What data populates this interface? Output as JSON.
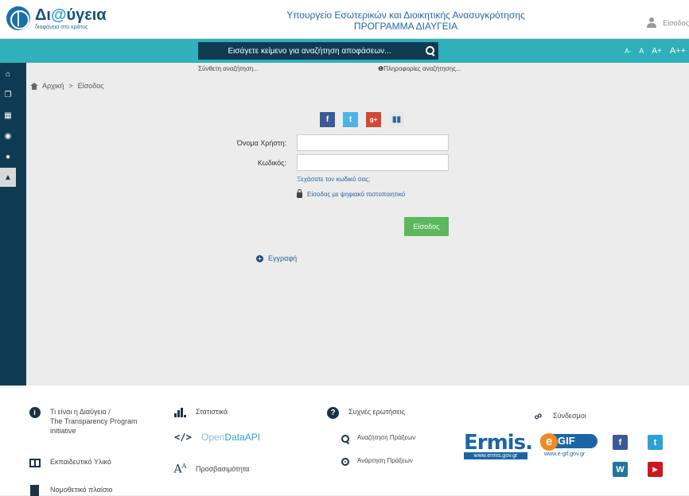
{
  "header": {
    "logo_title": "Δι@ύγεια",
    "logo_subtitle": "διαφάνεια στο κράτος",
    "ministry_line1": "Υπουργείο Εσωτερικών και Διοικητικής Ανασυγκρότησης",
    "ministry_line2": "ΠΡΟΓΡΑΜΜΑ ΔΙΑΥΓΕΙΑ",
    "user_label": "Είσοδος"
  },
  "search": {
    "placeholder": "Εισάγετε κείμενο για αναζήτηση αποφάσεων...",
    "advanced_label": "Σύνθετη αναζήτηση...",
    "info_label": "Πληροφορίες αναζήτησης..."
  },
  "font_sizes": [
    "A-",
    "A",
    "A+",
    "A++"
  ],
  "sidebar": {
    "items": [
      {
        "icon": "home-icon",
        "glyph": "⌂"
      },
      {
        "icon": "bookmark-icon",
        "glyph": "❐"
      },
      {
        "icon": "table-icon",
        "glyph": "▦"
      },
      {
        "icon": "globe-icon",
        "glyph": "◉"
      },
      {
        "icon": "chat-icon",
        "glyph": "●"
      },
      {
        "icon": "user-icon",
        "glyph": "▲"
      }
    ],
    "active_index": 5
  },
  "breadcrumb": {
    "home": "Αρχική",
    "separator": ">",
    "current": "Είσοδος"
  },
  "social": {
    "facebook": "f",
    "twitter": "t",
    "gplus": "g+",
    "gov": "gov"
  },
  "login": {
    "username_label": "Όνομα Χρήστη:",
    "username_value": "",
    "password_label": "Κωδικός:",
    "password_value": "",
    "forgot_label": "Ξεχάσατε τον κωδικό σας;",
    "certificate_label": "Είσοδος με ψηφιακό πιστοποιητικό",
    "submit_label": "Είσοδος",
    "register_label": "Εγγραφή"
  },
  "footer": {
    "about_line1": "Τι είναι η Διαύγεια /",
    "about_line2": "The Transparency Program",
    "about_line3": "initiative",
    "educational": "Εκπαιδευτικό Υλικό",
    "legal": "Νομοθετικό πλαίσιο",
    "statistics": "Στατιστικά",
    "opendata_open": "Open",
    "opendata_data": "Data",
    "opendata_api": "API",
    "accessibility": "Προσβασιμότητα",
    "faq": "Συχνές ερωτήσεις",
    "search_acts": "Αναζήτηση Πράξεων",
    "publish_acts": "Ανάρτηση Πράξεων",
    "links": "Σύνδεσμοι",
    "ermis_word": "Ermis.",
    "ermis_url": "www.ermis.gov.gr",
    "egif_word": "GIF",
    "egif_url": "www.e-gif.gov.gr"
  },
  "colors": {
    "teal": "#2fb0ba",
    "navy": "#0f3b52",
    "green": "#5cb85c",
    "link_blue": "#2467a3"
  }
}
